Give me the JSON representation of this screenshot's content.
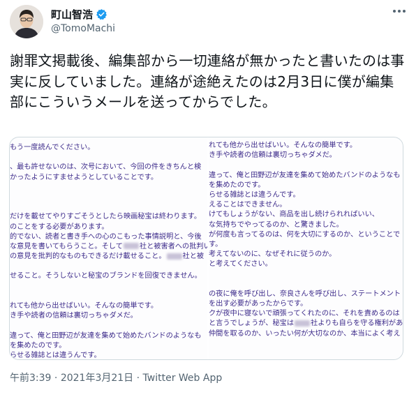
{
  "author": {
    "name": "町山智浩",
    "handle": "@TomoMachi",
    "verified_color": "#1d9bf0"
  },
  "tweet": {
    "text": "謝罪文掲載後、編集部から一切連絡が無かったと書いたのは事実に反していました。連絡が途絶えたのは2月3日に僕が編集部にこういうメールを送ってからでした。"
  },
  "media": {
    "left_lines": [
      "もう一度読んでください。",
      "",
      "、最も許せないのは、次号において、今回の件をきちんと検",
      "かったようにすませようとしていることです。",
      "",
      "",
      "",
      "だけを載せてやりすごそうとしたら映画秘宝は終わります。",
      "のことをする必要があります。",
      "的でない、読者と書き手への心のこもった事情説明と、今後",
      "な意見を書いてもらうこと。そして[B]社と被害者への批判い",
      "の意見を批判的なものもできるだけ載せること。[B]社と被",
      "",
      "せること。そうしないと秘宝のブランドを回復できません。",
      "",
      "",
      "れても他から出せばいい。そんなの簡単です。",
      "き手や読者の信頼は裏切っちゃダメだ。",
      "",
      "違って、俺と田野辺が友達を集めて始めたバンドのようなも",
      "を集めたのです。",
      "らせる雑誌とは違うんです。"
    ],
    "right_lines": [
      "れても他から出せばいい。そんなの簡単です。",
      "き手や読者の信頼は裏切っちゃダメだ。",
      "",
      "違って、俺と田野辺が友達を集めて始めたバンドのようなも",
      "を集めたのです。",
      "らせる雑誌とは違うんです。",
      "えることはできません。",
      "けてもしょうがない、商品を出し続けられればいい、",
      "な気持ちでやってるのか、と驚きました。",
      "が何度も言ってるのは、何を大切にするのか、ということで",
      "す。",
      "考えてないのに、なぜそれに従うのか。",
      "と考えてください。",
      "",
      "",
      "の夜に俺を呼び出し、奈良さんを呼び出し、ステートメント",
      "を出す必要があったからです。",
      "クが夜中に寝ないで頑張ってくれたのに、それを責めるのは",
      "と言うでしょうが、秘宝は[B]社よりも自らを守る権利があ",
      "仲間を取るのか、いったい何が大切なのか、本当によく考え"
    ]
  },
  "meta": {
    "time": "午前3:39",
    "separator": " · ",
    "date": "2021年3月21日",
    "source": "Twitter Web App"
  }
}
